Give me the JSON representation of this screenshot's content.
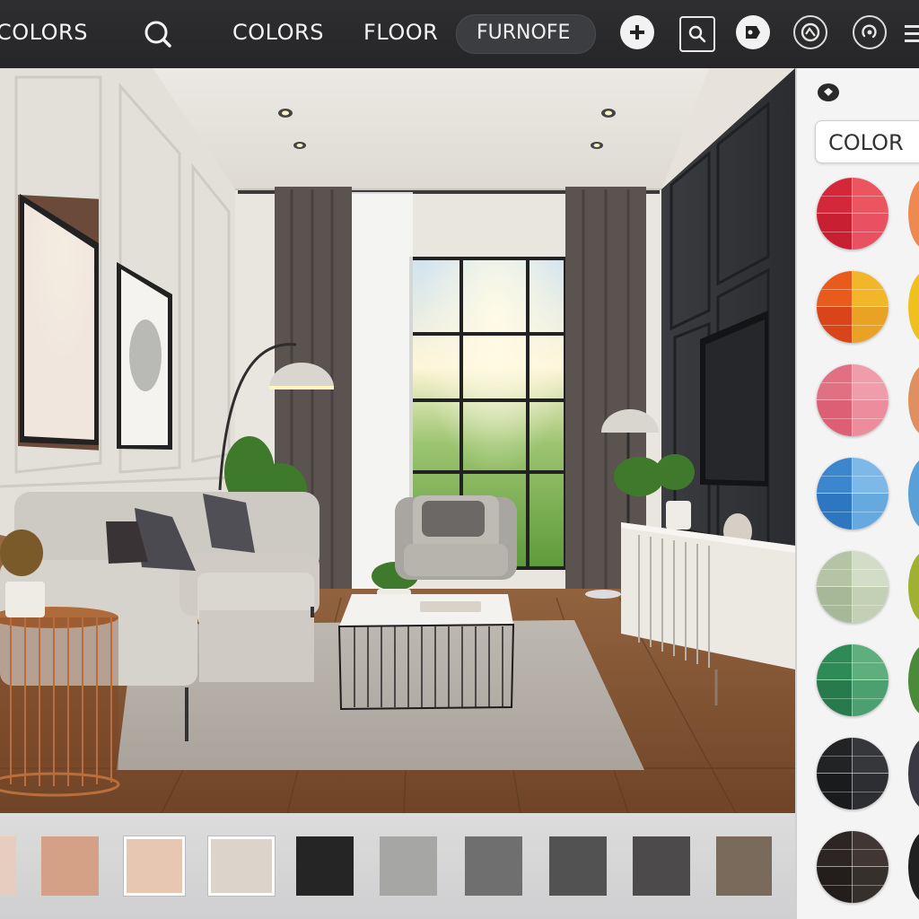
{
  "topbar": {
    "tab_colors_left": "COLORS",
    "tab_colors": "COLORS",
    "tab_floor": "FLOOR",
    "tab_furniture": "FURNOFE",
    "icons": [
      "search-icon",
      "add-icon",
      "zoom-icon",
      "tag-icon",
      "camera-icon",
      "rotate-icon",
      "menu-icon"
    ]
  },
  "panel": {
    "field_label": "COLOR",
    "swatches": [
      {
        "name": "red",
        "colors": [
          "#d4283a",
          "#ea5560",
          "#c91f33",
          "#e95061"
        ]
      },
      {
        "name": "orange-yellow",
        "colors": [
          "#e85b1c",
          "#f1b62a",
          "#d9451a",
          "#e9a223"
        ]
      },
      {
        "name": "pink",
        "colors": [
          "#e07082",
          "#ef9dab",
          "#dc5f75",
          "#ec8c9c"
        ]
      },
      {
        "name": "blue",
        "colors": [
          "#3b86cc",
          "#7cb9e8",
          "#2e76bf",
          "#65a9de"
        ]
      },
      {
        "name": "sage",
        "colors": [
          "#b4c4a4",
          "#d2dcc6",
          "#a6b897",
          "#c3d0b6"
        ]
      },
      {
        "name": "green",
        "colors": [
          "#2e8b57",
          "#5fae7e",
          "#267a4b",
          "#4c9f6e"
        ]
      },
      {
        "name": "black",
        "colors": [
          "#222325",
          "#36373a",
          "#1a1b1d",
          "#2d2e31"
        ]
      },
      {
        "name": "dark-brown",
        "colors": [
          "#2c2523",
          "#403633",
          "#231d1b",
          "#36302d"
        ]
      }
    ],
    "edge_swatches": [
      "#ee8a50",
      "#f0c020",
      "#e09060",
      "#5aa0d8",
      "#a0b030",
      "#4a8a3a",
      "#3a3840",
      "#202020"
    ]
  },
  "bottom_swatches": [
    {
      "color": "#e6cdbf",
      "selected": false
    },
    {
      "color": "#d4a187",
      "selected": false
    },
    {
      "color": "#e8c7b2",
      "selected": true
    },
    {
      "color": "#dcd4cb",
      "selected": true
    },
    {
      "color": "#252526",
      "selected": false
    },
    {
      "color": "#a6a6a4",
      "selected": false
    },
    {
      "color": "#6f6f70",
      "selected": false
    },
    {
      "color": "#525253",
      "selected": false
    },
    {
      "color": "#4c4a4a",
      "selected": false
    },
    {
      "color": "#7a6a5c",
      "selected": false
    }
  ]
}
